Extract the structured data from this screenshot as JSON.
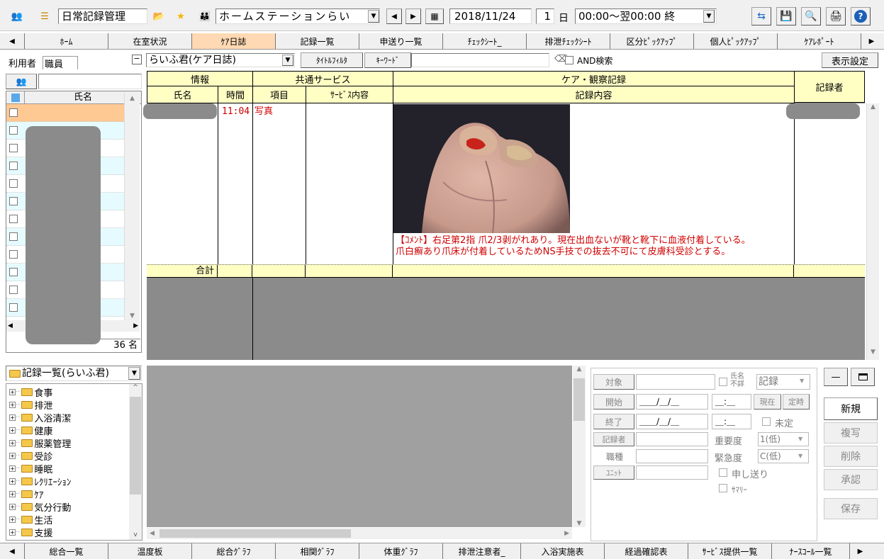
{
  "toolbar": {
    "title": "日常記録管理",
    "station": "ホームステーションらい",
    "date": "2018/11/24",
    "days": "1",
    "days_unit": "日",
    "time_range": "00:00～翌00:00 終"
  },
  "main_tabs": [
    {
      "label": "ﾎｰﾑ",
      "w": 118
    },
    {
      "label": "在室状況",
      "w": 118
    },
    {
      "label": "ｹｱ日誌",
      "w": 118,
      "active": true
    },
    {
      "label": "記録一覧",
      "w": 118
    },
    {
      "label": "申送り一覧",
      "w": 118
    },
    {
      "label": "ﾁｪｯｸｼｰﾄ_",
      "w": 118
    },
    {
      "label": "排泄ﾁｪｯｸｼｰﾄ",
      "w": 118
    },
    {
      "label": "区分ﾋﾟｯｸｱｯﾌﾟ",
      "w": 118
    },
    {
      "label": "個人ﾋﾟｯｸｱｯﾌﾟ",
      "w": 118
    },
    {
      "label": "ｹｱﾚﾎﾟｰﾄ",
      "w": 118
    }
  ],
  "left_tabs": {
    "users": "利用者",
    "staff": "職員"
  },
  "user_list": {
    "header": "氏名",
    "count": "36",
    "count_unit": "名"
  },
  "filter": {
    "mode": "らいふ君(ケア日誌)",
    "title_filter": "ﾀｲﾄﾙﾌｨﾙﾀ",
    "keyword_label": "ｷｰﾜｰﾄﾞ",
    "and_search": "AND検索",
    "display_settings": "表示設定"
  },
  "grid": {
    "groups": {
      "info": "情報",
      "common": "共通サービス",
      "care": "ケア・観察記録",
      "recorder": "記録者"
    },
    "cols": {
      "name": "氏名",
      "time": "時間",
      "item": "項目",
      "service": "ｻｰﾋﾞｽ内容",
      "content": "記録内容"
    },
    "row": {
      "time": "11:04",
      "item": "写真"
    },
    "comment_line1": "【ｺﾒﾝﾄ】右足第2指 爪2/3剥がれあり。現在出血ないが靴と靴下に血液付着している。",
    "comment_line2": "爪白癬あり爪床が付着しているためNS手技での抜去不可にて皮膚科受診とする。",
    "total": "合計"
  },
  "record_tree": {
    "title": "記録一覧(らいふ君)",
    "items": [
      "食事",
      "排泄",
      "入浴清潔",
      "健康",
      "服薬管理",
      "受診",
      "睡眠",
      "ﾚｸﾘｴｰｼｮﾝ",
      "ｹｱ",
      "気分行動",
      "生活",
      "支援"
    ]
  },
  "form": {
    "target": "対象",
    "name_unknown1": "氏名",
    "name_unknown2": "不詳",
    "record_kind": "記録",
    "start": "開始",
    "end": "終了",
    "date_placeholder": "＿＿/＿/＿",
    "time_placeholder": "＿:＿",
    "now": "現在",
    "fixed": "定時",
    "undetermined": "未定",
    "recorder": "記録者",
    "importance": "重要度",
    "importance_val": "1(低)",
    "job": "職種",
    "urgency": "緊急度",
    "urgency_val": "C(低)",
    "unit": "ﾕﾆｯﾄ",
    "handover": "申し送り",
    "summary": "ｻﾏﾘｰ"
  },
  "actions": {
    "new": "新規",
    "copy": "複写",
    "delete": "削除",
    "approve": "承認",
    "save": "保存"
  },
  "bottom_tabs": [
    {
      "label": "総合一覧",
      "w": 118
    },
    {
      "label": "温度板",
      "w": 118
    },
    {
      "label": "総合ｸﾞﾗﾌ",
      "w": 118
    },
    {
      "label": "相関ｸﾞﾗﾌ",
      "w": 118
    },
    {
      "label": "体重ｸﾞﾗﾌ",
      "w": 118
    },
    {
      "label": "排泄注意者_",
      "w": 110
    },
    {
      "label": "入浴実施表",
      "w": 118
    },
    {
      "label": "経過確認表",
      "w": 118
    },
    {
      "label": "ｻｰﾋﾞｽ提供一覧",
      "w": 118
    },
    {
      "label": "ﾅｰｽｺｰﾙ一覧",
      "w": 110
    }
  ]
}
